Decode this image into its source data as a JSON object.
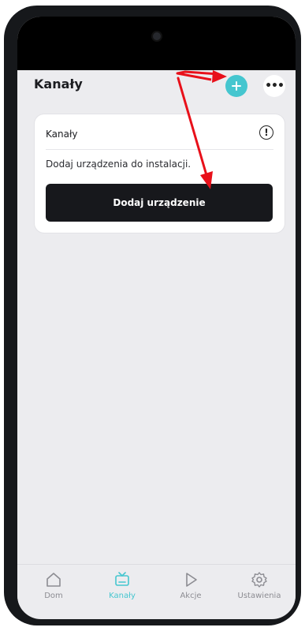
{
  "header": {
    "title": "Kanały"
  },
  "card": {
    "title": "Kanały",
    "message": "Dodaj urządzenia do instalacji.",
    "button_label": "Dodaj urządzenie"
  },
  "tabs": [
    {
      "label": "Dom",
      "icon": "home-icon",
      "active": false
    },
    {
      "label": "Kanały",
      "icon": "tv-icon",
      "active": true
    },
    {
      "label": "Akcje",
      "icon": "play-icon",
      "active": false
    },
    {
      "label": "Ustawienia",
      "icon": "settings-gear-icon",
      "active": false
    }
  ],
  "colors": {
    "accent": "#45c6cf",
    "button_dark": "#17181c",
    "annotation_arrow": "#e8101a"
  }
}
